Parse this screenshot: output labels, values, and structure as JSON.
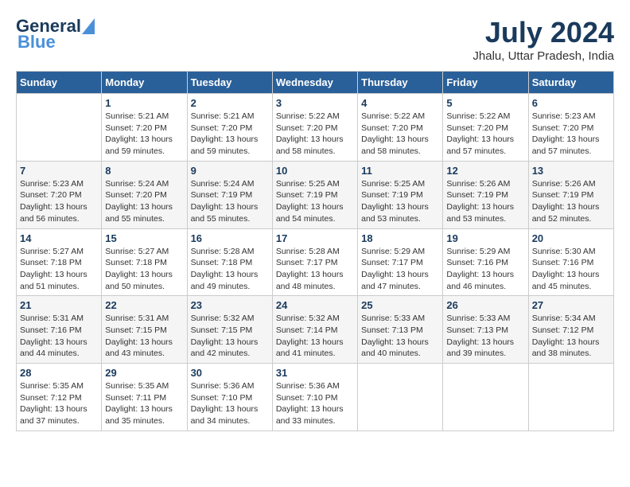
{
  "header": {
    "logo_general": "General",
    "logo_blue": "Blue",
    "month_year": "July 2024",
    "location": "Jhalu, Uttar Pradesh, India"
  },
  "calendar": {
    "days_of_week": [
      "Sunday",
      "Monday",
      "Tuesday",
      "Wednesday",
      "Thursday",
      "Friday",
      "Saturday"
    ],
    "weeks": [
      [
        {
          "day": "",
          "info": ""
        },
        {
          "day": "1",
          "info": "Sunrise: 5:21 AM\nSunset: 7:20 PM\nDaylight: 13 hours\nand 59 minutes."
        },
        {
          "day": "2",
          "info": "Sunrise: 5:21 AM\nSunset: 7:20 PM\nDaylight: 13 hours\nand 59 minutes."
        },
        {
          "day": "3",
          "info": "Sunrise: 5:22 AM\nSunset: 7:20 PM\nDaylight: 13 hours\nand 58 minutes."
        },
        {
          "day": "4",
          "info": "Sunrise: 5:22 AM\nSunset: 7:20 PM\nDaylight: 13 hours\nand 58 minutes."
        },
        {
          "day": "5",
          "info": "Sunrise: 5:22 AM\nSunset: 7:20 PM\nDaylight: 13 hours\nand 57 minutes."
        },
        {
          "day": "6",
          "info": "Sunrise: 5:23 AM\nSunset: 7:20 PM\nDaylight: 13 hours\nand 57 minutes."
        }
      ],
      [
        {
          "day": "7",
          "info": "Sunrise: 5:23 AM\nSunset: 7:20 PM\nDaylight: 13 hours\nand 56 minutes."
        },
        {
          "day": "8",
          "info": "Sunrise: 5:24 AM\nSunset: 7:20 PM\nDaylight: 13 hours\nand 55 minutes."
        },
        {
          "day": "9",
          "info": "Sunrise: 5:24 AM\nSunset: 7:19 PM\nDaylight: 13 hours\nand 55 minutes."
        },
        {
          "day": "10",
          "info": "Sunrise: 5:25 AM\nSunset: 7:19 PM\nDaylight: 13 hours\nand 54 minutes."
        },
        {
          "day": "11",
          "info": "Sunrise: 5:25 AM\nSunset: 7:19 PM\nDaylight: 13 hours\nand 53 minutes."
        },
        {
          "day": "12",
          "info": "Sunrise: 5:26 AM\nSunset: 7:19 PM\nDaylight: 13 hours\nand 53 minutes."
        },
        {
          "day": "13",
          "info": "Sunrise: 5:26 AM\nSunset: 7:19 PM\nDaylight: 13 hours\nand 52 minutes."
        }
      ],
      [
        {
          "day": "14",
          "info": "Sunrise: 5:27 AM\nSunset: 7:18 PM\nDaylight: 13 hours\nand 51 minutes."
        },
        {
          "day": "15",
          "info": "Sunrise: 5:27 AM\nSunset: 7:18 PM\nDaylight: 13 hours\nand 50 minutes."
        },
        {
          "day": "16",
          "info": "Sunrise: 5:28 AM\nSunset: 7:18 PM\nDaylight: 13 hours\nand 49 minutes."
        },
        {
          "day": "17",
          "info": "Sunrise: 5:28 AM\nSunset: 7:17 PM\nDaylight: 13 hours\nand 48 minutes."
        },
        {
          "day": "18",
          "info": "Sunrise: 5:29 AM\nSunset: 7:17 PM\nDaylight: 13 hours\nand 47 minutes."
        },
        {
          "day": "19",
          "info": "Sunrise: 5:29 AM\nSunset: 7:16 PM\nDaylight: 13 hours\nand 46 minutes."
        },
        {
          "day": "20",
          "info": "Sunrise: 5:30 AM\nSunset: 7:16 PM\nDaylight: 13 hours\nand 45 minutes."
        }
      ],
      [
        {
          "day": "21",
          "info": "Sunrise: 5:31 AM\nSunset: 7:16 PM\nDaylight: 13 hours\nand 44 minutes."
        },
        {
          "day": "22",
          "info": "Sunrise: 5:31 AM\nSunset: 7:15 PM\nDaylight: 13 hours\nand 43 minutes."
        },
        {
          "day": "23",
          "info": "Sunrise: 5:32 AM\nSunset: 7:15 PM\nDaylight: 13 hours\nand 42 minutes."
        },
        {
          "day": "24",
          "info": "Sunrise: 5:32 AM\nSunset: 7:14 PM\nDaylight: 13 hours\nand 41 minutes."
        },
        {
          "day": "25",
          "info": "Sunrise: 5:33 AM\nSunset: 7:13 PM\nDaylight: 13 hours\nand 40 minutes."
        },
        {
          "day": "26",
          "info": "Sunrise: 5:33 AM\nSunset: 7:13 PM\nDaylight: 13 hours\nand 39 minutes."
        },
        {
          "day": "27",
          "info": "Sunrise: 5:34 AM\nSunset: 7:12 PM\nDaylight: 13 hours\nand 38 minutes."
        }
      ],
      [
        {
          "day": "28",
          "info": "Sunrise: 5:35 AM\nSunset: 7:12 PM\nDaylight: 13 hours\nand 37 minutes."
        },
        {
          "day": "29",
          "info": "Sunrise: 5:35 AM\nSunset: 7:11 PM\nDaylight: 13 hours\nand 35 minutes."
        },
        {
          "day": "30",
          "info": "Sunrise: 5:36 AM\nSunset: 7:10 PM\nDaylight: 13 hours\nand 34 minutes."
        },
        {
          "day": "31",
          "info": "Sunrise: 5:36 AM\nSunset: 7:10 PM\nDaylight: 13 hours\nand 33 minutes."
        },
        {
          "day": "",
          "info": ""
        },
        {
          "day": "",
          "info": ""
        },
        {
          "day": "",
          "info": ""
        }
      ]
    ]
  }
}
